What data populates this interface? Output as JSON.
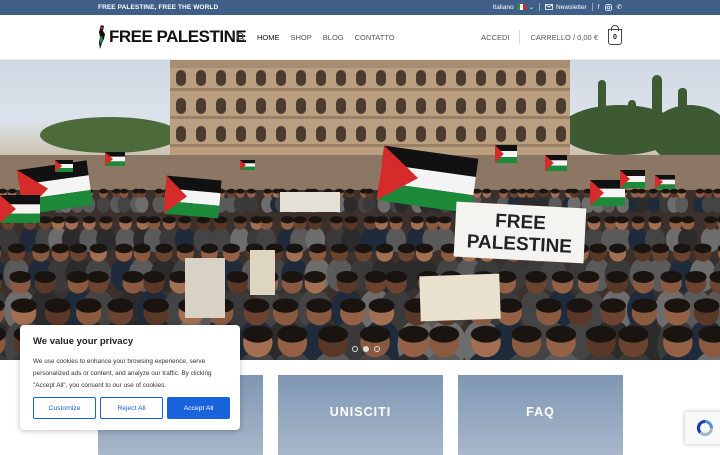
{
  "topbar": {
    "tagline": "FREE PALESTINE, FREE THE WORLD",
    "language": "Italiano",
    "newsletter": "Newsletter",
    "social_icons": [
      "facebook-icon",
      "instagram-icon",
      "phone-icon"
    ]
  },
  "header": {
    "logo_text": "FREE PALESTINE",
    "nav": [
      "HOME",
      "SHOP",
      "BLOG",
      "CONTATTO"
    ],
    "login": "ACCEDI",
    "cart_label": "CARRELLO / 0,00 €",
    "cart_count": "0"
  },
  "hero": {
    "banner_text": [
      "FREE",
      "PALESTINE"
    ],
    "slider_dots": 3,
    "active_dot": 1
  },
  "tiles": [
    "",
    "UNISCITI",
    "FAQ"
  ],
  "cookie": {
    "title": "We value your privacy",
    "body": "We use cookies to enhance your browsing experience, serve personalized ads or content, and analyze our traffic. By clicking \"Accept All\", you consent to our use of cookies.",
    "customize": "Customize",
    "reject": "Reject All",
    "accept": "Accept All"
  },
  "colors": {
    "topbar": "#3f5f89",
    "accent": "#1863dc",
    "flag_red": "#d62b2b",
    "flag_green": "#1d8a3a"
  }
}
